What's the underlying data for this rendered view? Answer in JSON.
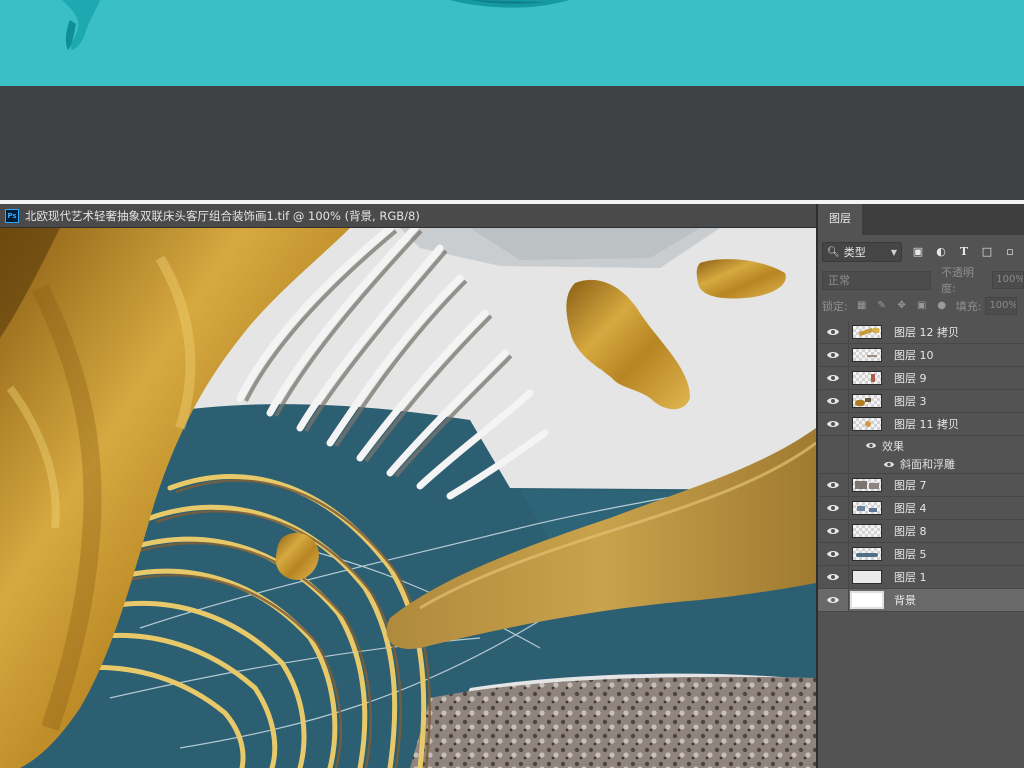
{
  "document": {
    "title": "北欧现代艺术轻奢抽象双联床头客厅组合装饰画1.tif @ 100% (背景, RGB/8)",
    "app_badge": "Ps"
  },
  "panel": {
    "tab_label": "图层",
    "filter_label": "类型",
    "blend_mode": "正常",
    "opacity_label": "不透明度:",
    "opacity_value": "100%",
    "lock_label": "锁定:",
    "fill_label": "填充:",
    "fill_value": "100%"
  },
  "layers": [
    {
      "name": "图层 12 拷贝",
      "visible": true,
      "thumb": "gold-stroke"
    },
    {
      "name": "图层 10",
      "visible": true,
      "thumb": "grey-stroke"
    },
    {
      "name": "图层 9",
      "visible": true,
      "thumb": "red-mark"
    },
    {
      "name": "图层 3",
      "visible": true,
      "thumb": "gold-blob"
    },
    {
      "name": "图层 11 拷贝",
      "visible": true,
      "thumb": "gold-dot",
      "effects_label": "效果",
      "effect_item": "斜面和浮雕"
    },
    {
      "name": "图层 7",
      "visible": true,
      "thumb": "stone"
    },
    {
      "name": "图层 4",
      "visible": true,
      "thumb": "blue-marble"
    },
    {
      "name": "图层 8",
      "visible": true,
      "thumb": "checker"
    },
    {
      "name": "图层 5",
      "visible": true,
      "thumb": "blue-wave"
    },
    {
      "name": "图层 1",
      "visible": true,
      "thumb": "plain"
    },
    {
      "name": "背景",
      "visible": true,
      "thumb": "white",
      "selected": true
    }
  ],
  "colors": {
    "teal_preview": "#3abfc6",
    "gold": "#c49a3a",
    "teal_blue": "#2e6276"
  }
}
